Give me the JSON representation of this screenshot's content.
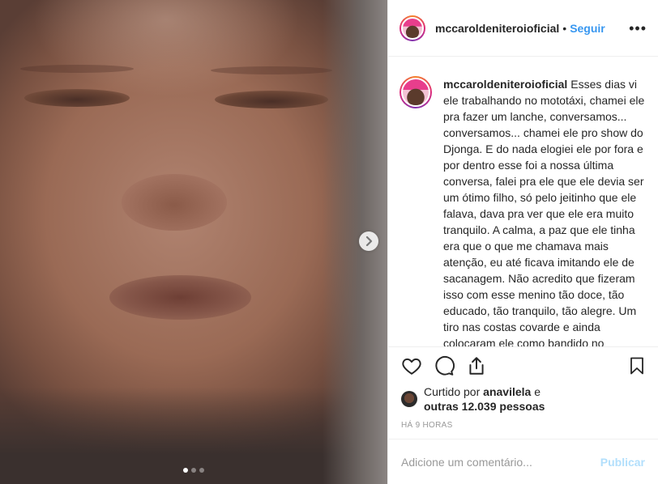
{
  "header": {
    "username": "mccaroldeniteroioficial",
    "separator": "•",
    "follow_label": "Seguir",
    "more_icon": "•••"
  },
  "caption": {
    "username": "mccaroldeniteroioficial",
    "text": "Esses dias vi ele trabalhando no mototáxi, chamei ele pra fazer um lanche, conversamos... conversamos... chamei ele pro show do Djonga. E do nada elogiei ele por fora e por dentro esse foi a nossa última conversa, falei pra ele que ele devia ser um ótimo filho, só pelo jeitinho que ele falava, dava pra ver que ele era muito tranquilo. A calma, a paz que ele tinha era que o que me chamava mais atenção, eu até ficava imitando ele de sacanagem. Não acredito que fizeram isso com esse menino tão doce, tão educado, tão tranquilo, tão alegre. Um tiro nas costas covarde e ainda colocaram ele como bandido no normal. Mas agora pelo menos ele está em um lugar"
  },
  "actions": {
    "icons": [
      "heart-icon",
      "comment-icon",
      "share-icon",
      "bookmark-icon"
    ]
  },
  "likes": {
    "prefix": "Curtido por",
    "liker": "anavilela",
    "conj": "e",
    "others": "outras 12.039 pessoas"
  },
  "timestamp": "HÁ 9 HORAS",
  "comment_box": {
    "placeholder": "Adicione um comentário...",
    "publish_label": "Publicar"
  },
  "carousel": {
    "slide_count": 3,
    "active_index": 0
  },
  "colors": {
    "accent": "#3897f0",
    "publish_disabled": "#b2dffc",
    "muted": "#999999",
    "border": "#efefef"
  }
}
